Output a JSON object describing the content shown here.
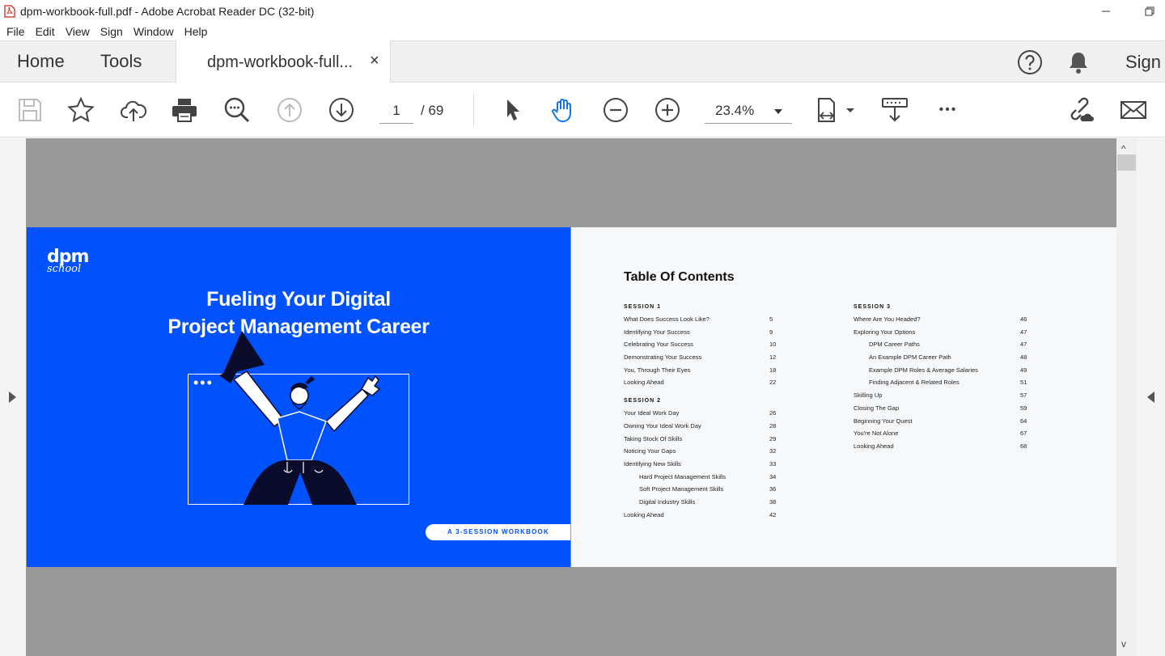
{
  "window": {
    "title": "dpm-workbook-full.pdf - Adobe Acrobat Reader DC (32-bit)"
  },
  "menu": [
    "File",
    "Edit",
    "View",
    "Sign",
    "Window",
    "Help"
  ],
  "tabs": {
    "home": "Home",
    "tools": "Tools",
    "document": "dpm-workbook-full...",
    "close": "×",
    "sign": "Sign"
  },
  "toolbar": {
    "page_current": "1",
    "page_total": "/ 69",
    "zoom": "23.4%",
    "more": "•••"
  },
  "scrollbar": {
    "up": "^",
    "down": "v"
  },
  "cover": {
    "logo_top": "dpm",
    "logo_bottom": "school",
    "title_line1": "Fueling Your Digital",
    "title_line2": "Project Management Career",
    "dots": "•••",
    "pill": "A 3-SESSION WORKBOOK",
    "brand_color": "#0052ff"
  },
  "toc": {
    "heading": "Table Of Contents",
    "col1": [
      {
        "session": "SESSION 1"
      },
      {
        "text": "What Does Success Look Like?",
        "page": "5"
      },
      {
        "text": "Identifying Your Success",
        "page": "9"
      },
      {
        "text": "Celebrating Your Success",
        "page": "10"
      },
      {
        "text": "Demonstrating Your Success",
        "page": "12"
      },
      {
        "text": "You, Through Their Eyes",
        "page": "18"
      },
      {
        "text": "Looking Ahead",
        "page": "22"
      },
      {
        "session": "SESSION 2"
      },
      {
        "text": "Your Ideal Work Day",
        "page": "26"
      },
      {
        "text": "Owning Your Ideal Work Day",
        "page": "28"
      },
      {
        "text": "Taking Stock Of Skills",
        "page": "29"
      },
      {
        "text": "Noticing Your Gaps",
        "page": "32"
      },
      {
        "text": "Identifying New Skills",
        "page": "33"
      },
      {
        "text": "Hard Project Management Skills",
        "page": "34",
        "sub": true
      },
      {
        "text": "Soft Project Management Skills",
        "page": "36",
        "sub": true
      },
      {
        "text": "Digital Industry Skills",
        "page": "38",
        "sub": true
      },
      {
        "text": "Looking Ahead",
        "page": "42"
      }
    ],
    "col2": [
      {
        "session": "SESSION 3"
      },
      {
        "text": "Where Are You Headed?",
        "page": "46"
      },
      {
        "text": "Exploring Your Options",
        "page": "47"
      },
      {
        "text": "DPM Career Paths",
        "page": "47",
        "sub": true
      },
      {
        "text": "An Example DPM Career Path",
        "page": "48",
        "sub": true
      },
      {
        "text": "Example DPM Roles & Average Salaries",
        "page": "49",
        "sub": true
      },
      {
        "text": "Finding Adjacent & Related Roles",
        "page": "51",
        "sub": true
      },
      {
        "text": "Skilling Up",
        "page": "57"
      },
      {
        "text": "Closing The Gap",
        "page": "59"
      },
      {
        "text": "Beginning Your Quest",
        "page": "64"
      },
      {
        "text": "You're Not Alone",
        "page": "67"
      },
      {
        "text": "Looking Ahead",
        "page": "68"
      }
    ]
  },
  "icons": {
    "save": "save-icon",
    "bookmark": "star-icon",
    "upload": "cloud-upload-icon",
    "print": "printer-icon",
    "find": "search-icon",
    "prev": "arrow-up-icon",
    "next": "arrow-down-icon",
    "select": "cursor-icon",
    "hand": "hand-icon",
    "zoom_out": "zoom-out-icon",
    "zoom_in": "zoom-in-icon",
    "fit": "page-fit-icon",
    "scroll": "scroll-mode-icon",
    "link": "share-link-icon",
    "mail": "mail-icon"
  },
  "colors": {
    "accent": "#1473e6",
    "viewer_bg": "#999999"
  }
}
